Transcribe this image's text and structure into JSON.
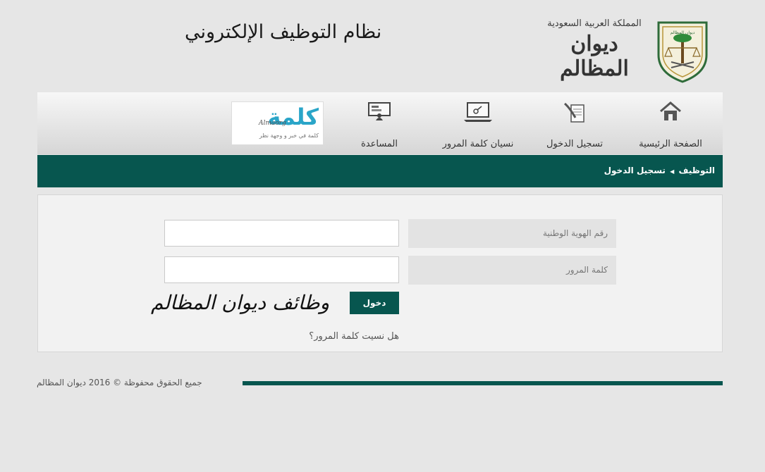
{
  "header": {
    "system_title": "نظام التوظيف الإلكتروني",
    "logo_kingdom": "المملكة العربية السعودية",
    "logo_name": "ديوان المظالم"
  },
  "nav": {
    "items": [
      {
        "label": "الصفحة الرئيسية",
        "icon": "home-icon"
      },
      {
        "label": "تسجيل الدخول",
        "icon": "sign-document-icon"
      },
      {
        "label": "نسيان كلمة المرور",
        "icon": "laptop-key-icon"
      },
      {
        "label": "المساعدة",
        "icon": "help-desk-icon"
      }
    ],
    "ad": {
      "word": "كلمة",
      "latin": "Almaorg",
      "slogan": "كلمة في خبر و وجهة نظر"
    }
  },
  "breadcrumb": {
    "root": "التوظيف",
    "current": "تسجيل الدخول"
  },
  "form": {
    "national_id_label": "رقم الهوية الوطنية",
    "national_id_value": "",
    "password_label": "كلمة المرور",
    "password_value": "",
    "login_button": "دخول",
    "forgot_link": "هل نسيت كلمة المرور؟",
    "watermark": "وظائف ديوان المظالم"
  },
  "footer": {
    "copyright": "جميع الحقوق محفوظة © 2016 ديوان المظالم"
  },
  "colors": {
    "brand_green": "#07564f",
    "ad_blue": "#2aa5c8",
    "page_bg": "#e6e6e6"
  }
}
